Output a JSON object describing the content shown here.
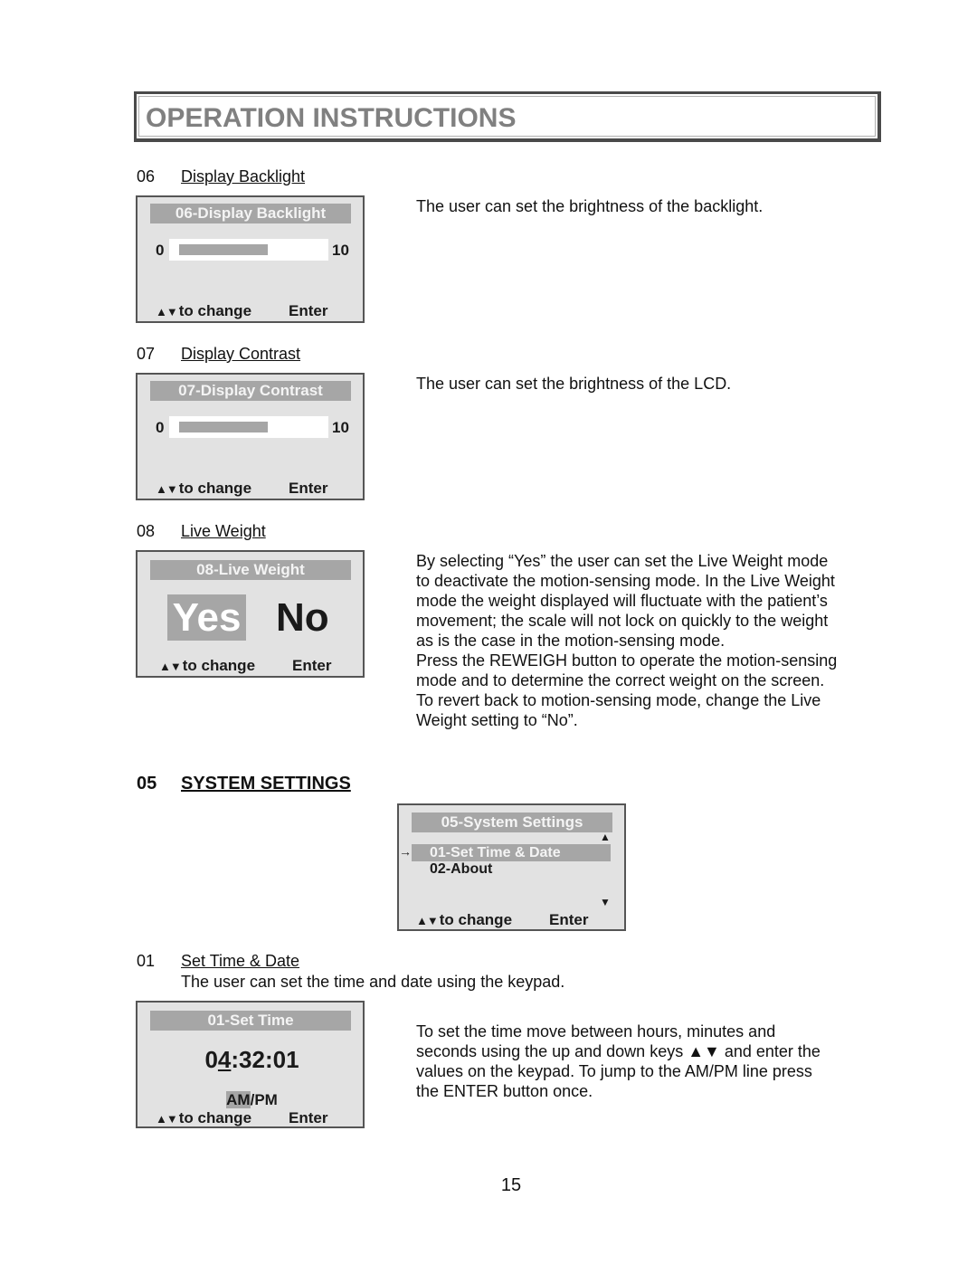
{
  "header": {
    "title": "OPERATION INSTRUCTIONS"
  },
  "sections": [
    {
      "number": "06",
      "title": "Display Backlight",
      "description": "The user can set the brightness of the backlight.",
      "screen": {
        "title": "06-Display Backlight",
        "min_label": "0",
        "max_label": "10",
        "level_fraction": 0.62,
        "hint_arrows": "▲▼",
        "hint_label": "to change",
        "enter_label": "Enter"
      }
    },
    {
      "number": "07",
      "title": "Display Contrast",
      "description": "The user can set the brightness of the LCD.",
      "screen": {
        "title": "07-Display Contrast",
        "min_label": "0",
        "max_label": "10",
        "level_fraction": 0.62,
        "hint_arrows": "▲▼",
        "hint_label": "to change",
        "enter_label": "Enter"
      }
    },
    {
      "number": "08",
      "title": "Live Weight",
      "description_lines": [
        "By selecting “Yes” the user can set the Live Weight mode",
        "to deactivate the motion-sensing mode. In the Live Weight",
        "mode the weight displayed will fluctuate with the patient’s",
        "movement; the scale will not lock on quickly to the weight",
        "as is the case in the motion-sensing mode.",
        "Press the REWEIGH button to operate the motion-sensing",
        "mode and to determine the correct weight on the screen.",
        "To revert back to motion-sensing mode, change the Live",
        "Weight setting to “No”."
      ],
      "screen": {
        "title": "08-Live Weight",
        "option_yes": "Yes",
        "option_no": "No",
        "selected": "Yes",
        "hint_arrows": "▲▼",
        "hint_label": "to change",
        "enter_label": "Enter"
      }
    }
  ],
  "system_settings": {
    "number": "05",
    "title": "SYSTEM SETTINGS",
    "screen": {
      "title": "05-System Settings",
      "scroll_up": "▲",
      "scroll_down": "▼",
      "pointer": "→",
      "items": [
        {
          "label": "01-Set Time & Date",
          "selected": true
        },
        {
          "label": "02-About",
          "selected": false
        }
      ],
      "hint_arrows": "▲▼",
      "hint_label": "to change",
      "enter_label": "Enter"
    }
  },
  "set_time": {
    "number": "01",
    "title": "Set Time & Date",
    "intro": "The user can set the time and date using the keypad.",
    "description_lines": [
      "To set the time move between hours, minutes and",
      "seconds using the up and down keys ▲▼ and enter the",
      "values on the keypad. To jump to the AM/PM line press",
      "the ENTER button once."
    ],
    "screen": {
      "title": "01-Set Time",
      "time_prefix": "0",
      "time_cursor_digit": "4",
      "time_suffix": ":32:01",
      "ampm_selected": "AM",
      "ampm_rest": "/PM",
      "hint_arrows": "▲▼",
      "hint_label": "to change",
      "enter_label": "Enter"
    }
  },
  "footer": {
    "page_number": "15"
  }
}
